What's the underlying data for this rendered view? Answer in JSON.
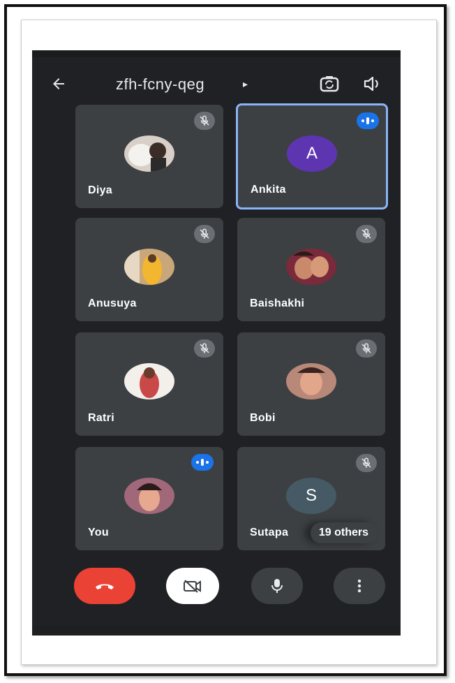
{
  "meeting": {
    "code": "zfh-fcny-qeg",
    "caret": "▸"
  },
  "icons": {
    "back": "arrow-left-icon",
    "switch_camera": "switch-camera-icon",
    "speaker": "speaker-icon",
    "mic_off": "mic-off-icon",
    "speaking": "speaking-indicator-icon",
    "end_call": "phone-hangup-icon",
    "video_off": "video-off-icon",
    "mic": "mic-icon",
    "more": "more-vert-icon"
  },
  "participants": [
    {
      "name": "Diya",
      "status": "muted"
    },
    {
      "name": "Ankita",
      "status": "speaking",
      "initial": "A",
      "avatar_color": "#5e35b1",
      "active": true
    },
    {
      "name": "Anusuya",
      "status": "muted"
    },
    {
      "name": "Baishakhi",
      "status": "muted"
    },
    {
      "name": "Ratri",
      "status": "muted"
    },
    {
      "name": "Bobi",
      "status": "muted"
    },
    {
      "name": "You",
      "status": "speaking"
    },
    {
      "name": "Sutapa",
      "status": "muted",
      "initial": "S",
      "avatar_color": "#455a64",
      "others": "19 others"
    }
  ],
  "colors": {
    "background": "#202124",
    "tile": "#3c4043",
    "accent": "#8ab4f8",
    "speaking": "#1a73e8",
    "end_call": "#ea4335"
  }
}
